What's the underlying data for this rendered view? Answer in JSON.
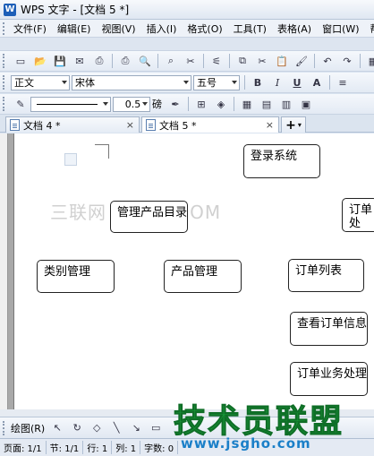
{
  "window": {
    "title": "WPS 文字 - [文档 5 *]",
    "app_icon": "W"
  },
  "menu": [
    "文件(F)",
    "编辑(E)",
    "视图(V)",
    "插入(I)",
    "格式(O)",
    "工具(T)",
    "表格(A)",
    "窗口(W)",
    "帮"
  ],
  "toolbar1": {
    "icons": [
      "new-doc-icon",
      "open-folder-icon",
      "save-icon",
      "email-icon",
      "pdf-icon",
      "print-icon",
      "print-preview-icon",
      "find-icon",
      "scissors-icon",
      "format-painter-icon",
      "copy-icon",
      "cut-icon",
      "paste-icon",
      "brush-icon",
      "undo-icon",
      "redo-icon",
      "insert-table-icon"
    ]
  },
  "toolbar2": {
    "style": "正文",
    "font": "宋体",
    "size": "五号",
    "bold": "B",
    "italic": "I",
    "underline": "U",
    "font_color": "A"
  },
  "toolbar3": {
    "line_width": "0.5",
    "unit": "磅"
  },
  "tabs": [
    {
      "label": "文档 4 *"
    },
    {
      "label": "文档 5 *"
    }
  ],
  "new_tab": "+",
  "watermark_text": "三联网 3LIAN.COM",
  "diagram": {
    "nodes": [
      {
        "id": "login",
        "label": "登录系统"
      },
      {
        "id": "manage-products",
        "label": "管理产品目录"
      },
      {
        "id": "order-partial",
        "label": "订单处"
      },
      {
        "id": "category",
        "label": "类别管理"
      },
      {
        "id": "product",
        "label": "产品管理"
      },
      {
        "id": "order-list",
        "label": "订单列表"
      },
      {
        "id": "view-order",
        "label": "查看订单信息"
      },
      {
        "id": "order-business",
        "label": "订单业务处理"
      }
    ]
  },
  "drawbar": {
    "label": "绘图(R)"
  },
  "status": {
    "page": "页面: 1/1",
    "section": "节: 1/1",
    "row": "行: 1",
    "col": "列: 1",
    "words": "字数: 0"
  },
  "logo": {
    "title": "技术员联盟",
    "url": "www.jsgho.com"
  }
}
